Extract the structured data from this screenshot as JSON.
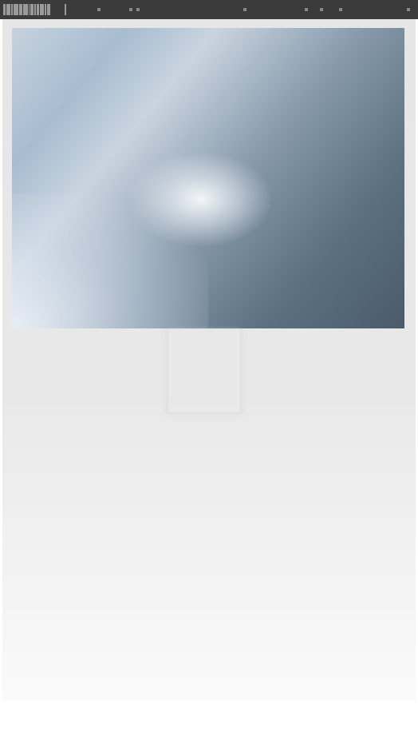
{
  "header": {
    "logo_icon": "barcode-logo-icon",
    "indicator_icons": [
      "status-indicator-icon",
      "status-indicator-icon",
      "status-indicator-icon",
      "status-indicator-icon",
      "status-indicator-icon",
      "status-indicator-icon",
      "status-indicator-icon",
      "status-indicator-icon"
    ]
  },
  "main": {
    "image_icon": "sky-photo"
  },
  "colors": {
    "topbar": "#3b3b3b",
    "panel": "#e6e6e6"
  }
}
